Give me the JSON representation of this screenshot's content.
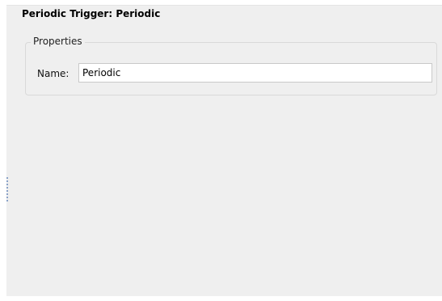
{
  "editor": {
    "title": "Periodic Trigger: Periodic"
  },
  "properties_group": {
    "legend": "Properties",
    "name_field": {
      "label": "Name:",
      "value": "Periodic"
    }
  },
  "colors": {
    "panel_background": "#efefef",
    "border": "#d9d9d9",
    "sash_dots": "#8aa2c8"
  }
}
